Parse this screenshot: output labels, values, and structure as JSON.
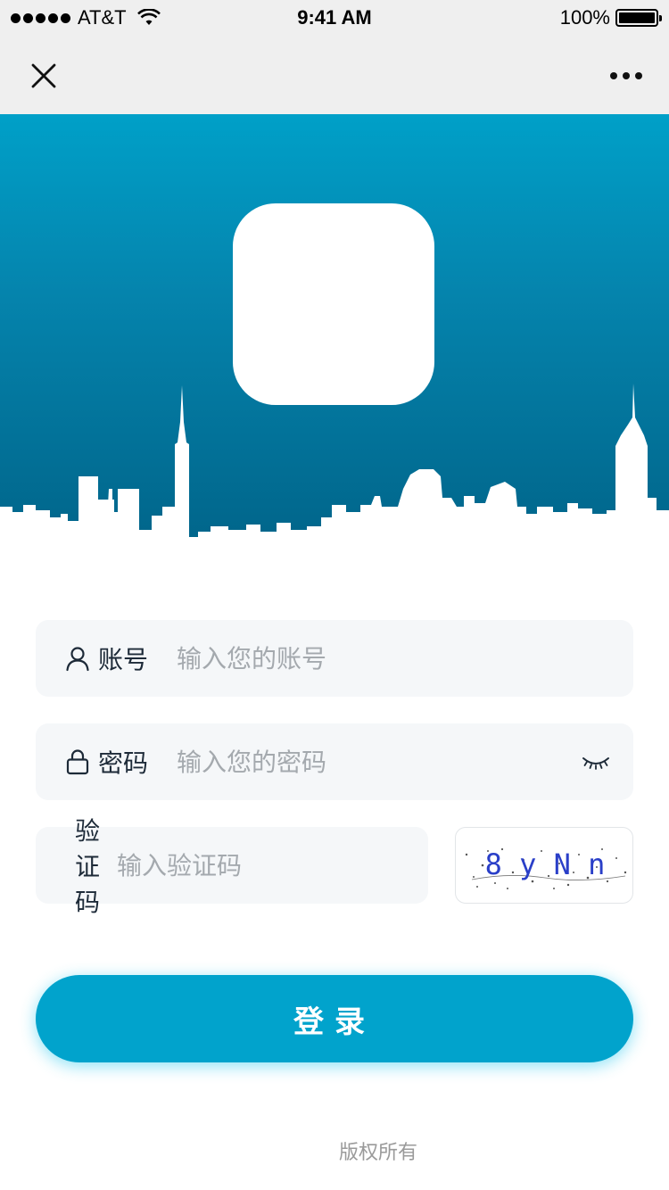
{
  "status_bar": {
    "carrier": "AT&T",
    "time": "9:41 AM",
    "battery": "100%"
  },
  "nav": {
    "close_icon": "close-icon",
    "more_icon": "more-icon"
  },
  "hero": {
    "background_top": "#00a0c8",
    "background_bottom": "#006388"
  },
  "form": {
    "account": {
      "label": "账号",
      "placeholder": "输入您的账号",
      "icon": "user-icon"
    },
    "password": {
      "label": "密码",
      "placeholder": "输入您的密码",
      "icon": "lock-icon",
      "toggle_icon": "eye-closed-icon"
    },
    "captcha": {
      "label": "验证码",
      "placeholder": "输入验证码",
      "code": "8 y N n"
    }
  },
  "login_button": {
    "label": "登录",
    "color": "#01a3cc"
  },
  "footer": {
    "copyright": "版权所有"
  }
}
